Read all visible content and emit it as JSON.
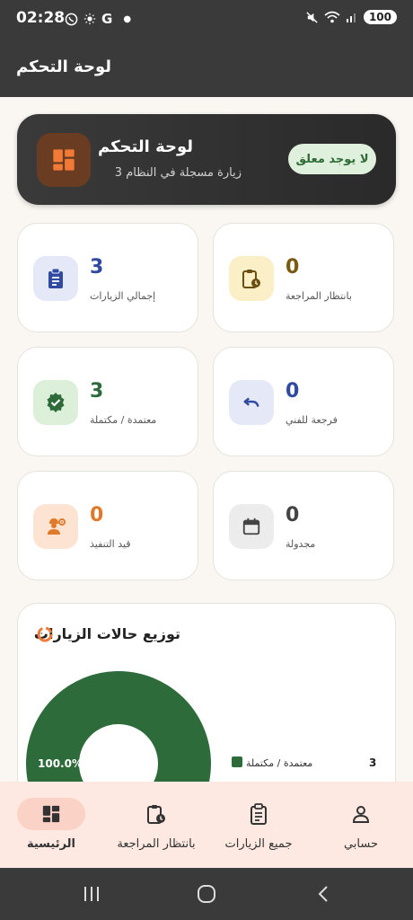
{
  "status_bar": {
    "time": "02:28",
    "left_icons": [
      "whatsapp-icon",
      "sun-icon",
      "g-icon",
      "dot-icon"
    ],
    "right_icons": [
      "mute-icon",
      "wifi-icon",
      "signal-icon"
    ],
    "battery": "100"
  },
  "app_bar": {
    "title": "لوحة التحكم"
  },
  "hero": {
    "title": "لوحة التحكم",
    "subtitle": "زيارة مسجلة في النظام 3",
    "badge": "لا يوجد معلق",
    "icon": "dashboard-icon"
  },
  "stats": [
    {
      "value": "3",
      "label": "إجمالي الزيارات",
      "icon": "clipboard-icon",
      "color": "#2f4aa0",
      "bg": "#e4e8f7"
    },
    {
      "value": "0",
      "label": "بانتظار المراجعة",
      "icon": "pending-icon",
      "color": "#7a5a10",
      "bg": "#fbefc8"
    },
    {
      "value": "3",
      "label": "معتمدة / مكتملة",
      "icon": "verified-icon",
      "color": "#2e6b3b",
      "bg": "#dcefd9"
    },
    {
      "value": "0",
      "label": "فرجعة للفني",
      "icon": "undo-icon",
      "color": "#2f4aa0",
      "bg": "#e4e8f7"
    },
    {
      "value": "0",
      "label": "قيد التنفيذ",
      "icon": "worker-icon",
      "color": "#e07a2a",
      "bg": "#fde4d2"
    },
    {
      "value": "0",
      "label": "مجدولة",
      "icon": "calendar-icon",
      "color": "#444444",
      "bg": "#ececec"
    }
  ],
  "chart_section": {
    "title": "توزيع حالات الزيارات",
    "icon": "donut-chart-icon"
  },
  "chart_data": {
    "type": "pie",
    "title": "توزيع حالات الزيارات",
    "categories": [
      "معتمدة / مكتملة"
    ],
    "values": [
      3
    ],
    "percent_labels": [
      "100.0%"
    ],
    "colors": [
      "#2e6b3b"
    ],
    "legend": "right"
  },
  "bottom_nav": {
    "items": [
      {
        "label": "الرئيسية",
        "icon": "dashboard-icon",
        "active": true
      },
      {
        "label": "بانتظار المراجعة",
        "icon": "pending-icon",
        "active": false
      },
      {
        "label": "جميع الزيارات",
        "icon": "clipboard-icon",
        "active": false
      },
      {
        "label": "حسابي",
        "icon": "person-icon",
        "active": false
      }
    ]
  },
  "colors": {
    "dark": "#3a3a3a",
    "accent": "#2e6b3b",
    "nav_bg": "#fde8e2",
    "nav_active": "#fbd3c6"
  }
}
